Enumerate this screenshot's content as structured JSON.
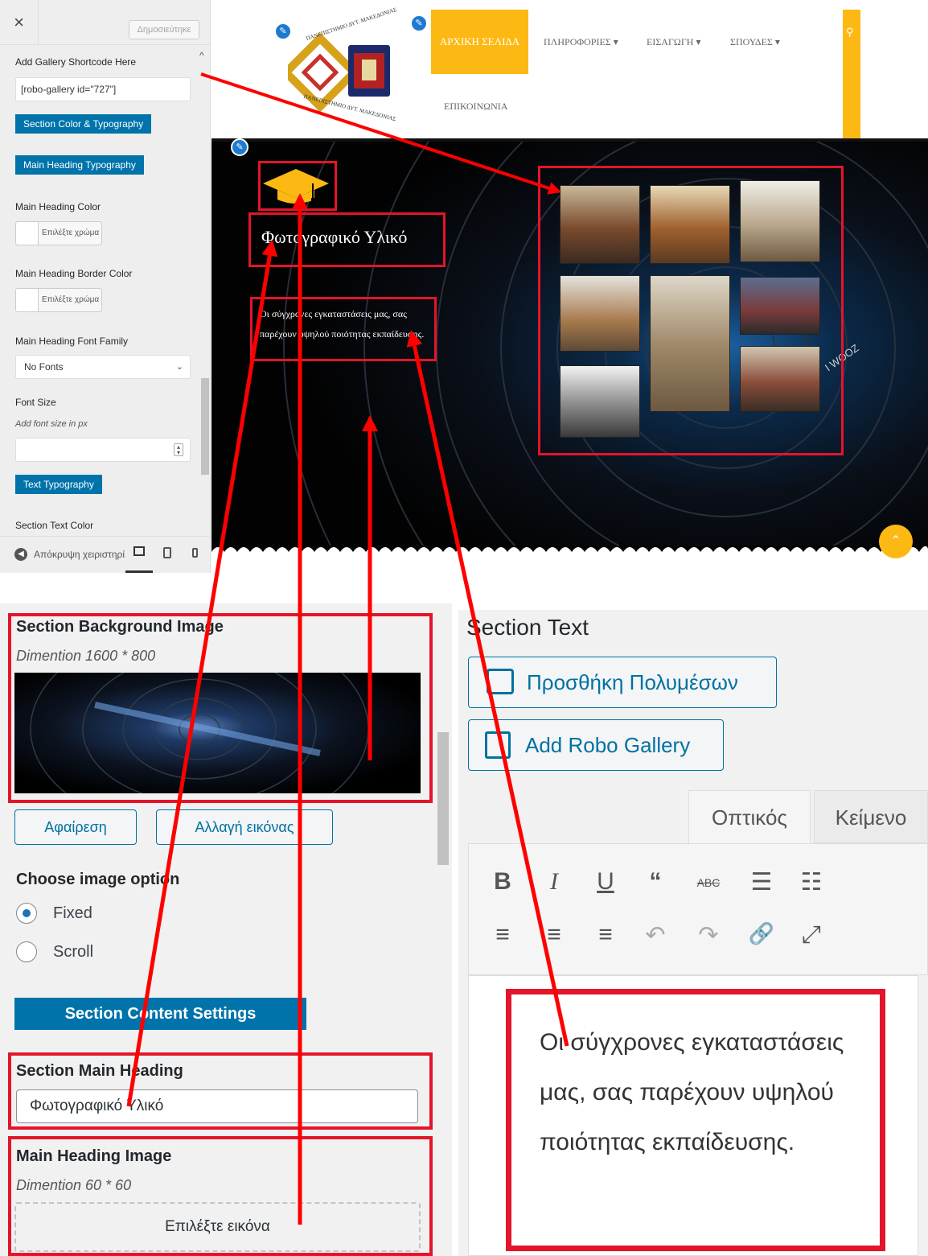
{
  "customizer": {
    "close_symbol": "×",
    "publish_label": "Δημοσιεύτηκε",
    "shortcode_label": "Add Gallery Shortcode Here",
    "shortcode_value": "[robo-gallery id=\"727\"]",
    "section_color_btn": "Section Color & Typography",
    "main_heading_typo_btn": "Main Heading Typography",
    "main_heading_color_label": "Main Heading Color",
    "choose_color": "Επιλέξτε χρώμα",
    "main_heading_border_label": "Main Heading Border Color",
    "font_family_label": "Main Heading Font Family",
    "font_family_value": "No Fonts",
    "font_size_label": "Font Size",
    "font_size_hint": "Add font size in px",
    "text_typo_btn": "Text Typography",
    "section_text_color_label": "Section Text Color",
    "hide_controls": "Απόκρυψη χειριστηρί"
  },
  "site": {
    "logo_top_text": "ΠΑΝΕΠΙΣΤΗΜΙΟ ΔΥΤ. ΜΑΚΕΔΟΝΙΑΣ",
    "logo_bottom_text": "ΠΑΝΕΠΙΣΤΗΜΙΟ ΔΥΤ. ΜΑΚΕΔΟΝΙΑΣ",
    "nav": {
      "home": "ΑΡΧΙΚΗ ΣΕΛΙΔΑ",
      "info": "ΠΛΗΡΟΦΟΡΙΕΣ",
      "intro": "ΕΙΣΑΓΩΓΗ",
      "studies": "ΣΠΟΥΔΕΣ",
      "contact": "ΕΠΙΚΟΙΝΩΝΙΑ"
    },
    "hero_heading": "Φωτογραφικό Υλικό",
    "hero_text": "Οι σύγχρονες εγκαταστάσεις μας, σας παρέχουν υψηλού ποιότητας εκπαίδευσης.",
    "lens_text": "I WOOZ"
  },
  "bottom_left": {
    "bg_image_label": "Section Background Image",
    "bg_image_dim": "Dimention 1600 * 800",
    "remove_btn": "Αφαίρεση",
    "change_btn": "Αλλαγή εικόνας",
    "choose_option_label": "Choose image option",
    "option_fixed": "Fixed",
    "option_scroll": "Scroll",
    "content_settings_btn": "Section Content Settings",
    "main_heading_label": "Section Main Heading",
    "main_heading_value": "Φωτογραφικό Υλικό",
    "heading_image_label": "Main Heading Image",
    "heading_image_dim": "Dimention 60 * 60",
    "choose_image": "Επιλέξτε εικόνα"
  },
  "bottom_right": {
    "section_text_label": "Section Text",
    "add_media_btn": "Προσθήκη Πολυμέσων",
    "add_robo_btn": "Add Robo Gallery",
    "tab_visual": "Οπτικός",
    "tab_text": "Κείμενο",
    "toolbar_row1": [
      "B",
      "I",
      "U",
      "“",
      "ABC",
      "☰",
      "☷"
    ],
    "toolbar_row2": [
      "≡",
      "≡",
      "≡",
      "↶",
      "↷",
      "🔗",
      "⤢"
    ],
    "editor_text": "Οι σύγχρονες εγκαταστάσεις μας, σας παρέχουν υψηλού ποιότητας εκπαίδευσης."
  },
  "colors": {
    "annotation_red": "#e3152a",
    "accent_yellow": "#fdb913",
    "wp_blue": "#0073aa"
  }
}
